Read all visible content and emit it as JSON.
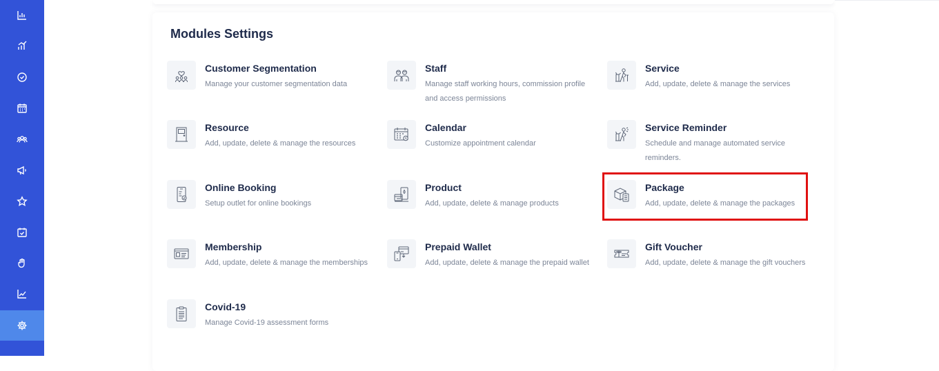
{
  "sidebar": {
    "bg_color": "#3253d8",
    "active_color": "#4f88ea",
    "items": [
      {
        "icon": "bar-chart-icon"
      },
      {
        "icon": "analytics-icon"
      },
      {
        "icon": "check-circle-icon"
      },
      {
        "icon": "calendar-icon"
      },
      {
        "icon": "customers-icon"
      },
      {
        "icon": "megaphone-icon"
      },
      {
        "icon": "star-icon"
      },
      {
        "icon": "calendar-check-icon"
      },
      {
        "icon": "hand-icon"
      },
      {
        "icon": "trend-chart-icon"
      },
      {
        "icon": "gear-icon",
        "active": true
      }
    ]
  },
  "page": {
    "title": "Modules Settings"
  },
  "modules": [
    {
      "icon": "customer-segmentation-icon",
      "title": "Customer Segmentation",
      "description": "Manage your customer segmentation data"
    },
    {
      "icon": "staff-icon",
      "title": "Staff",
      "description": "Manage staff working hours, commission profile and access permissions"
    },
    {
      "icon": "service-icon",
      "title": "Service",
      "description": "Add, update, delete & manage the services"
    },
    {
      "icon": "resource-door-icon",
      "title": "Resource",
      "description": "Add, update, delete & manage the resources"
    },
    {
      "icon": "calendar-icon",
      "title": "Calendar",
      "description": "Customize appointment calendar"
    },
    {
      "icon": "service-reminder-icon",
      "title": "Service Reminder",
      "description": "Schedule and manage automated service reminders."
    },
    {
      "icon": "online-booking-phone-icon",
      "title": "Online Booking",
      "description": "Setup outlet for online bookings"
    },
    {
      "icon": "product-icon",
      "title": "Product",
      "description": "Add, update, delete & manage products"
    },
    {
      "icon": "package-box-icon",
      "title": "Package",
      "description": "Add, update, delete & manage the packages",
      "highlighted": true
    },
    {
      "icon": "membership-card-icon",
      "title": "Membership",
      "description": "Add, update, delete & manage the memberships"
    },
    {
      "icon": "prepaid-wallet-icon",
      "title": "Prepaid Wallet",
      "description": "Add, update, delete & manage the prepaid wallet"
    },
    {
      "icon": "gift-voucher-icon",
      "title": "Gift Voucher",
      "description": "Add, update, delete & manage the gift vouchers"
    },
    {
      "icon": "clipboard-icon",
      "title": "Covid-19",
      "description": "Manage Covid-19 assessment forms"
    }
  ],
  "highlight_color": "#e01010"
}
